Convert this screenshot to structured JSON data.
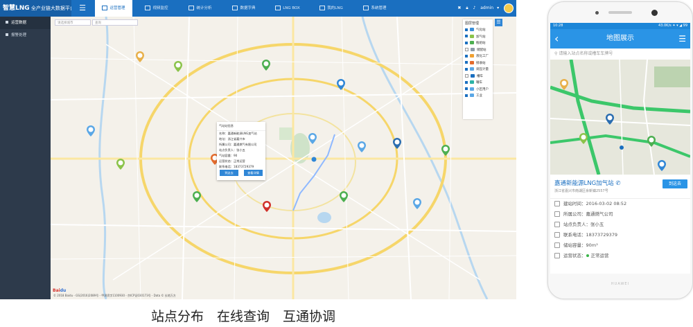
{
  "app": {
    "brand_main": "智慧LNG",
    "brand_sub": "全产业链大数据平台",
    "nav_tabs": [
      {
        "label": "运营管理",
        "active": true
      },
      {
        "label": "视频监控",
        "active": false
      },
      {
        "label": "统计分析",
        "active": false
      },
      {
        "label": "数据字典",
        "active": false
      },
      {
        "label": "LNG BOX",
        "active": false
      },
      {
        "label": "我的LNG",
        "active": false
      },
      {
        "label": "系统管理",
        "active": false
      }
    ],
    "user": "admin"
  },
  "sidebar": {
    "items": [
      {
        "label": "运营数据",
        "active": true
      },
      {
        "label": "报警处理",
        "active": false
      }
    ]
  },
  "map": {
    "search_city_placeholder": "请选择城市",
    "search_station_placeholder": "查询",
    "layer_panel": {
      "title": "图层管理",
      "rows": [
        {
          "label": "气化站",
          "checked": true,
          "color": "#3a8fd9"
        },
        {
          "label": "加气站",
          "checked": true,
          "color": "#8bc34a"
        },
        {
          "label": "瓶组站",
          "checked": true,
          "color": "#4caf50"
        },
        {
          "label": "储配站",
          "checked": false,
          "color": "#8d9aa8"
        },
        {
          "label": "液化工厂",
          "checked": true,
          "color": "#f0a030"
        },
        {
          "label": "接收站",
          "checked": true,
          "color": "#e36b2d"
        },
        {
          "label": "调压计量",
          "checked": true,
          "color": "#5aa7e6"
        },
        {
          "label": "槽车",
          "checked": false,
          "color": "#1a6fc0"
        },
        {
          "label": "罐车",
          "checked": true,
          "color": "#2bb3a6"
        },
        {
          "label": "小区用户",
          "checked": true,
          "color": "#5aa7e6"
        },
        {
          "label": "工业",
          "checked": true,
          "color": "#5aa7e6"
        }
      ]
    },
    "popup": {
      "title": "气站站信息",
      "rows": [
        "名称：嘉通新能源LNG加气站",
        "地址：浙江省嘉兴市",
        "所属公司：嘉通燃气有限公司",
        "站点负责人：张小五",
        "气站容量：90",
        "运营状态：正常运营",
        "联系电话：18373729379"
      ],
      "btn_route": "到这去",
      "btn_detail": "查看详情"
    },
    "footer": "© 2018 Baidu - GS(2016)2089号 - 甲测资字1100930 - 京ICP证030173号 - Data © 长地万方"
  },
  "caption": "站点分布　在线查询　互通协调",
  "mobile": {
    "status_time": "10:28",
    "status_right": "43.0K/s ✦ ▾ ◢ 99",
    "title": "地图展示",
    "search_placeholder": "请输入站点名称或槽车车牌号",
    "station": {
      "name": "嘉通新能源LNG加气站",
      "address": "浙江省嘉兴市南湖区余新镇2557号",
      "nav_button": "到这去",
      "rows": [
        {
          "label": "建站时间：",
          "value": "2016-03-02 08:52"
        },
        {
          "label": "所属公司：",
          "value": "嘉通燃气公司"
        },
        {
          "label": "站点负责人：",
          "value": "张小五"
        },
        {
          "label": "联系电话：",
          "value": "18373729379"
        },
        {
          "label": "储站容量：",
          "value": "90m³"
        },
        {
          "label": "运营状态：",
          "value": "正常运营"
        }
      ]
    },
    "bottom_brand": "HUAWEI"
  }
}
